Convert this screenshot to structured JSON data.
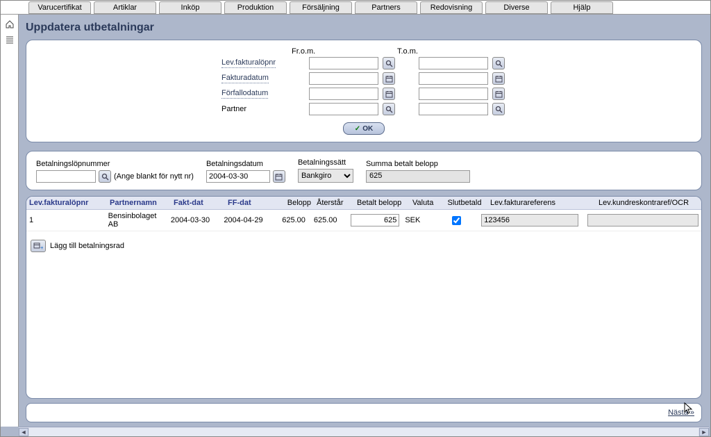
{
  "menu": [
    "Varucertifikat",
    "Artiklar",
    "Inköp",
    "Produktion",
    "Försäljning",
    "Partners",
    "Redovisning",
    "Diverse",
    "Hjälp"
  ],
  "page": {
    "title": "Uppdatera utbetalningar"
  },
  "filter": {
    "col_from": "Fr.o.m.",
    "col_to": "T.o.m.",
    "rows": {
      "levnr": "Lev.fakturalöpnr",
      "faktdat": "Fakturadatum",
      "ffdat": "Förfallodatum",
      "partner": "Partner"
    },
    "ok_label": "OK"
  },
  "payinfo": {
    "paynum_label": "Betalningslöpnummer",
    "paynum_hint": "(Ange blankt för nytt nr)",
    "paydate_label": "Betalningsdatum",
    "paydate_value": "2004-03-30",
    "method_label": "Betalningssätt",
    "method_value": "Bankgiro",
    "sum_label": "Summa betalt belopp",
    "sum_value": "625"
  },
  "table": {
    "headers": {
      "levnr": "Lev.fakturalöpnr",
      "partner": "Partnernamn",
      "faktdat": "Fakt-dat",
      "ffdat": "FF-dat",
      "belopp": "Belopp",
      "aterstar": "Återstår",
      "betalt": "Betalt belopp",
      "valuta": "Valuta",
      "slut": "Slutbetald",
      "ref": "Lev.fakturareferens",
      "ocr": "Lev.kundreskontraref/OCR"
    },
    "rows": [
      {
        "levnr": "1",
        "partner": "Bensinbolaget AB",
        "faktdat": "2004-03-30",
        "ffdat": "2004-04-29",
        "belopp": "625.00",
        "aterstar": "625.00",
        "betalt": "625",
        "valuta": "SEK",
        "slut": true,
        "ref": "123456",
        "ocr": ""
      }
    ],
    "add_row_label": "Lägg till betalningsrad"
  },
  "footer": {
    "next": "Nästa »"
  }
}
